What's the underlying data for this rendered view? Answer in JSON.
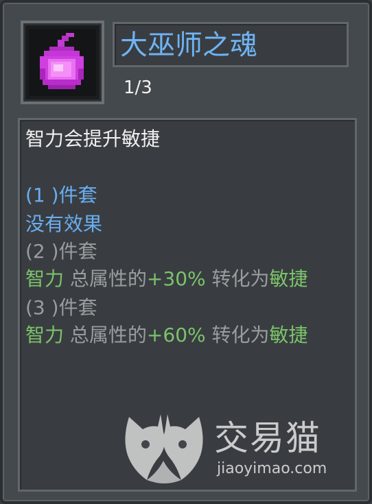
{
  "item": {
    "icon": "pink-soul-orb-icon",
    "name": "大巫师之魂",
    "level": "1/3"
  },
  "description": {
    "intro": "智力会提升敏捷",
    "set1": {
      "header": "(1 )件套",
      "effect": "没有效果"
    },
    "set2": {
      "header": "(2 )件套",
      "effect": {
        "stat_from": "智力",
        "middle": " 总属性的",
        "percent": "+30%",
        "convert": " 转化为",
        "stat_to": "敏捷"
      }
    },
    "set3": {
      "header": "(3 )件套",
      "effect": {
        "stat_from": "智力",
        "middle": " 总属性的",
        "percent": "+60%",
        "convert": " 转化为",
        "stat_to": "敏捷"
      }
    }
  },
  "watermark": {
    "icon": "cat-logo-icon",
    "brand": "交易猫",
    "url": "jiaoyimao.com"
  },
  "colors": {
    "title": "#6fb4f5",
    "active_set": "#6aaef2",
    "inactive_set": "#9a9d9f",
    "stat_green": "#7cc36a"
  }
}
